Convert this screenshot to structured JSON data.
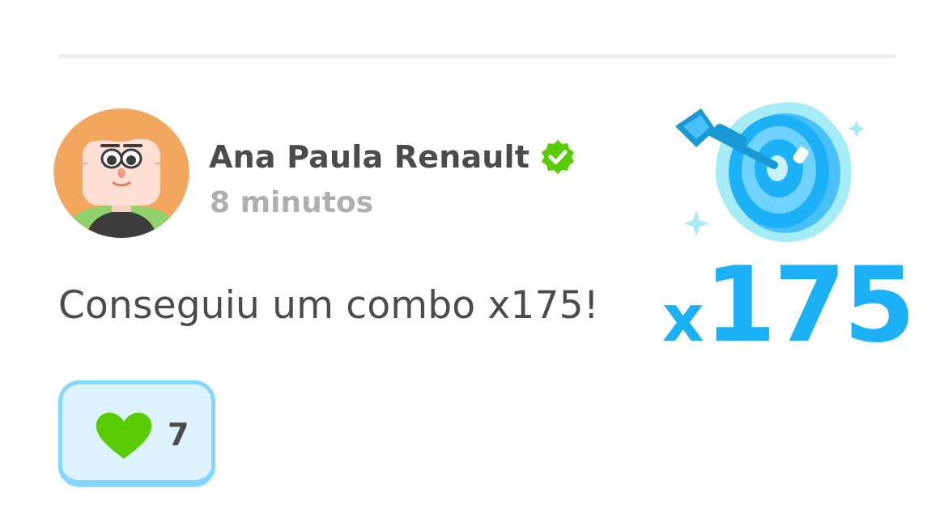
{
  "post": {
    "author": "Ana Paula Renault",
    "time": "8 minutos",
    "message": "Conseguiu um combo x175!",
    "likes": "7"
  },
  "combo_badge": {
    "prefix": "x",
    "number": "175"
  },
  "icons": {
    "verified": "verified-check-icon",
    "like": "heart-icon",
    "badge": "target-dart-icon"
  },
  "colors": {
    "text": "#4b4b4b",
    "muted": "#afafaf",
    "accent_blue": "#1cb0f6",
    "verified_green": "#58cc02",
    "like_bg": "#ddf4ff",
    "like_border": "#84d8ff"
  }
}
